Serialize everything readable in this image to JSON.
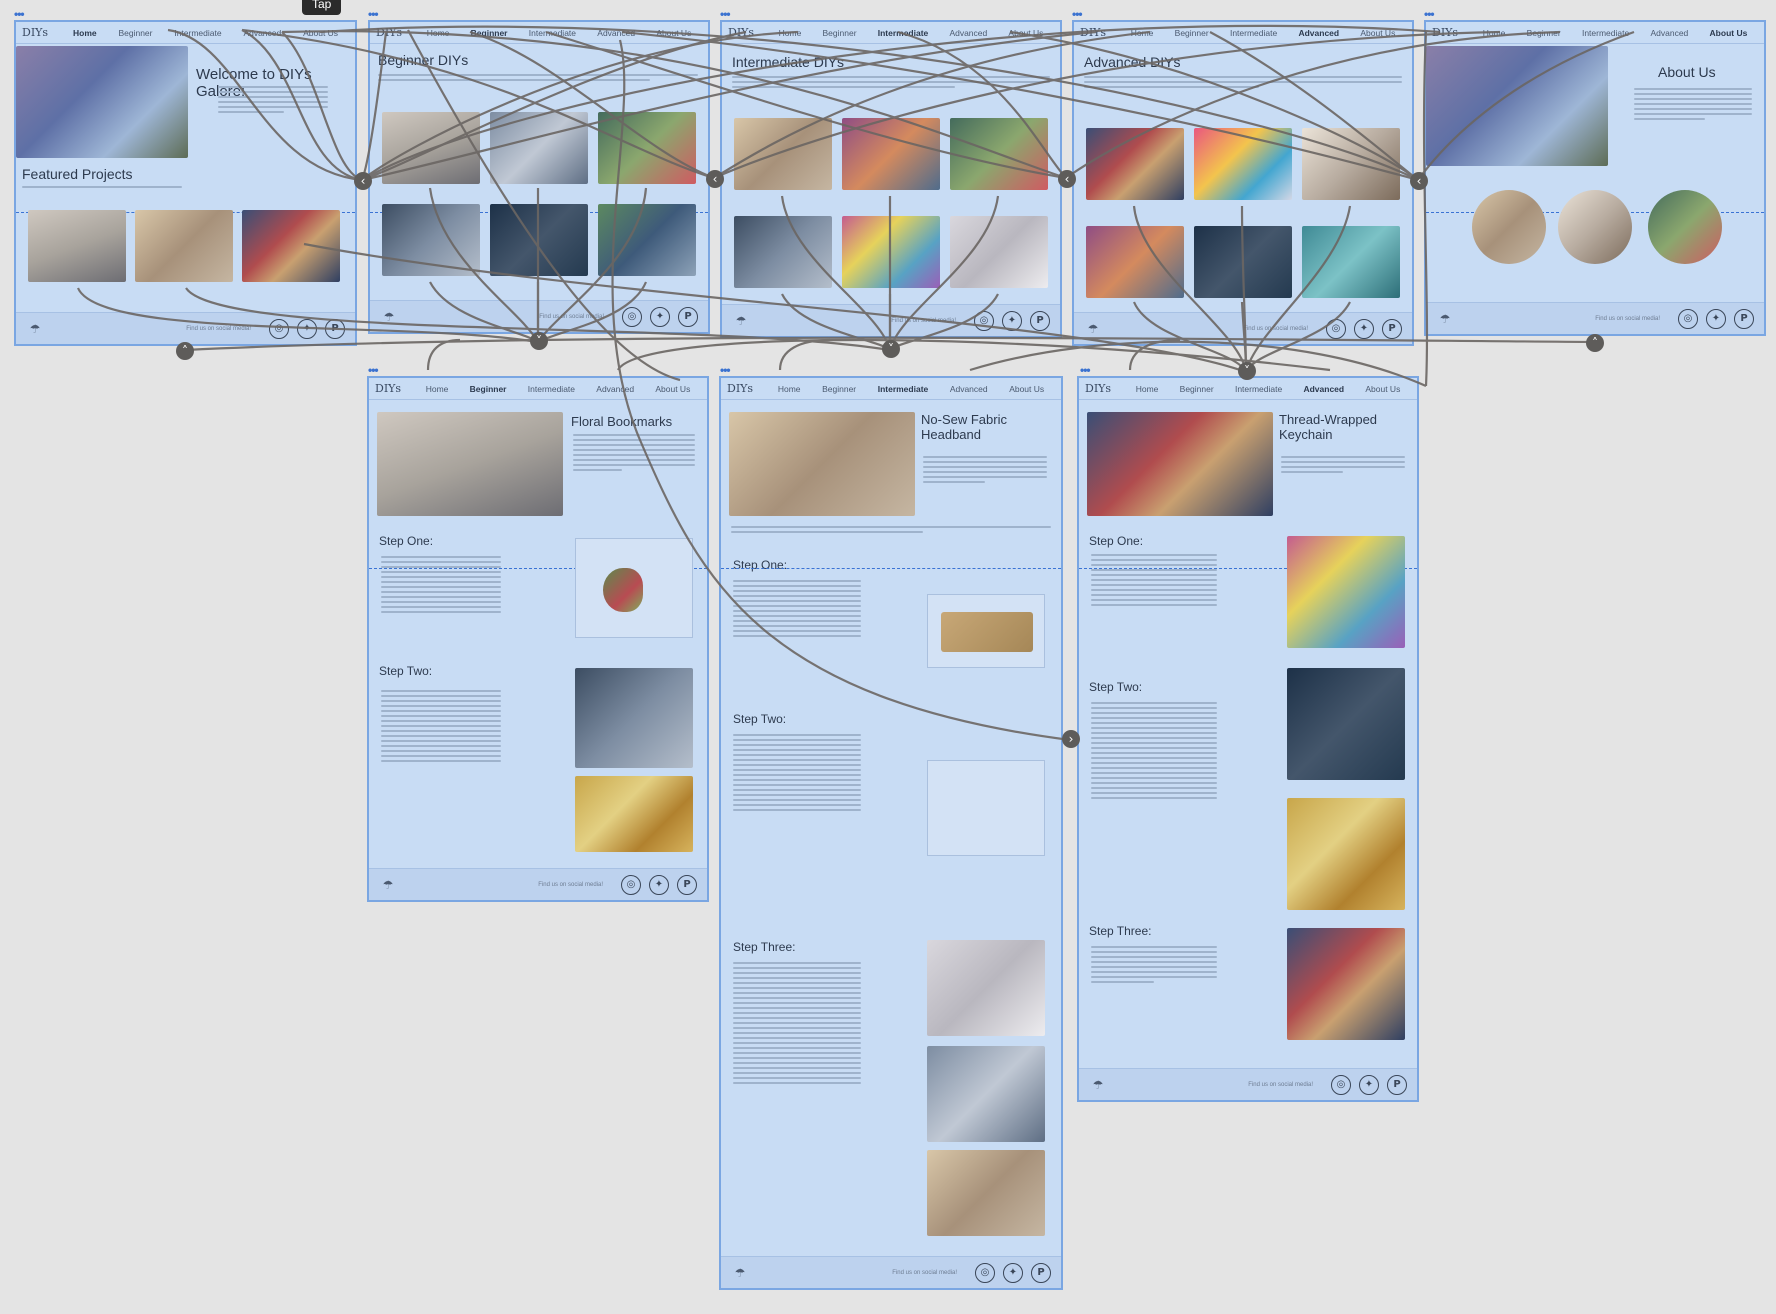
{
  "tooltip": "Tap",
  "frame_marker": "•••",
  "brand": "DIYs",
  "nav": [
    "Home",
    "Beginner",
    "Intermediate",
    "Advanced",
    "About Us"
  ],
  "footer_text": "Find us on social media!",
  "social_icons": [
    "instagram-icon",
    "twitter-icon",
    "pinterest-icon"
  ],
  "social_glyphs": [
    "◎",
    "✦",
    "P"
  ],
  "home": {
    "title": "Welcome to DIYs Galore!",
    "featured_title": "Featured Projects"
  },
  "beginner": {
    "title": "Beginner DIYs"
  },
  "intermediate": {
    "title": "Intermediate DIYs"
  },
  "advanced": {
    "title": "Advanced DIYs"
  },
  "about": {
    "title": "About Us"
  },
  "floral": {
    "title": "Floral Bookmarks",
    "step1": "Step One:",
    "step2": "Step Two:"
  },
  "headband": {
    "title": "No-Sew Fabric Headband",
    "step1": "Step One:",
    "step2": "Step Two:",
    "step3": "Step Three:"
  },
  "keychain": {
    "title": "Thread-Wrapped Keychain",
    "step1": "Step One:",
    "step2": "Step Two:",
    "step3": "Step Three:"
  },
  "colors": {
    "frame_bg": "#c8dcf4",
    "frame_border": "#7aa6e2",
    "wire": "#6b6663",
    "canvas": "#e4e4e4"
  }
}
